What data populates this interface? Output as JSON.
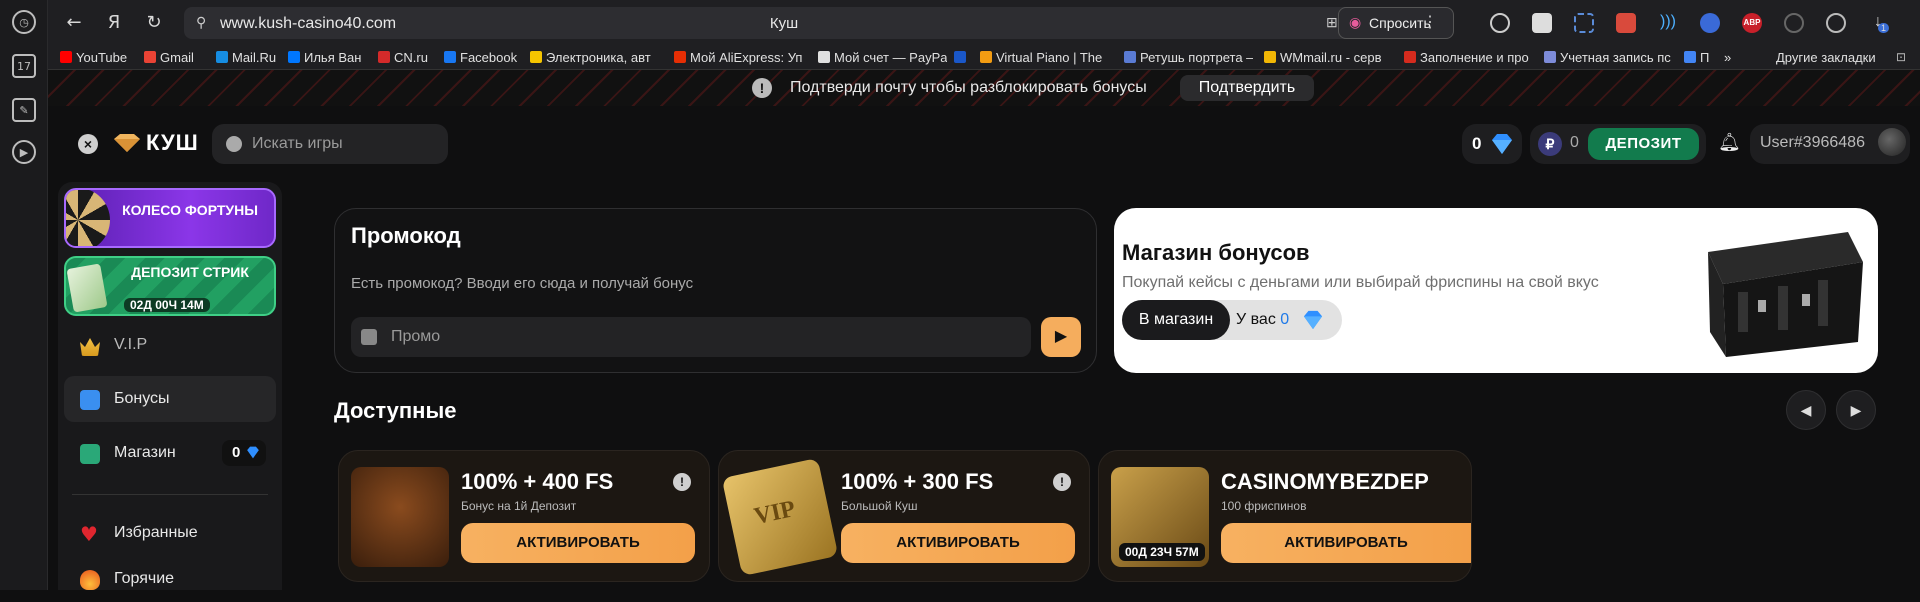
{
  "browser": {
    "url": "www.kush-casino40.com",
    "tab_title": "Куш",
    "ask_label": "Спросить",
    "rail_badge": "17",
    "bookmarks": [
      {
        "label": "YouTube",
        "color": "#ff0000"
      },
      {
        "label": "Gmail",
        "color": "#ea4335"
      },
      {
        "label": "Mail.Ru",
        "color": "#168de2"
      },
      {
        "label": "Илья Ван",
        "color": "#0077ff"
      },
      {
        "label": "CN.ru",
        "color": "#d42a2a"
      },
      {
        "label": "Facebook",
        "color": "#1877f2"
      },
      {
        "label": "Электроника, авт",
        "color": "#f5c400"
      },
      {
        "label": "Мой AliExpress: Уп",
        "color": "#e62e04"
      },
      {
        "label": "Мой счет — PayPa",
        "color": "#e0e0e0"
      },
      {
        "label": "",
        "color": "#1a57c8"
      },
      {
        "label": "Virtual Piano | The",
        "color": "#f39c12"
      },
      {
        "label": "Ретушь портрета –",
        "color": "#5a7bd4"
      },
      {
        "label": "WMmail.ru - серв",
        "color": "#f2b705"
      },
      {
        "label": "Заполнение и про",
        "color": "#d52b1e"
      },
      {
        "label": "Учетная запись пс",
        "color": "#7d8bd9"
      },
      {
        "label": "П",
        "color": "#4285f4"
      }
    ],
    "more_bookmarks": "»",
    "other_bookmarks": "Другие закладки",
    "ext_badge": "1"
  },
  "notice": {
    "text": "Подтверди почту чтобы разблокировать бонусы",
    "button": "Подтвердить"
  },
  "header": {
    "logo": "КУШ",
    "search_placeholder": "Искать игры",
    "gems": "0",
    "rub": "0",
    "deposit": "ДЕПОЗИТ",
    "user": "User#3966486"
  },
  "sidebar": {
    "wheel": "КОЛЕСО ФОРТУНЫ",
    "streak": "ДЕПОЗИТ СТРИК",
    "streak_timer": "02Д 00Ч 14М",
    "items": [
      {
        "label": "V.I.P"
      },
      {
        "label": "Бонусы"
      },
      {
        "label": "Магазин",
        "badge": "0"
      },
      {
        "label": "Избранные"
      },
      {
        "label": "Горячие"
      }
    ]
  },
  "promo": {
    "title": "Промокод",
    "subtitle": "Есть промокод? Вводи его сюда и получай бонус",
    "placeholder": "Промо"
  },
  "shop": {
    "title": "Магазин бонусов",
    "subtitle": "Покупай кейсы с деньгами или выбирай фриспины на свой вкус",
    "button": "В магазин",
    "have_label": "У вас",
    "have_count": "0"
  },
  "available": {
    "title": "Доступные",
    "cards": [
      {
        "title": "100% + 400 FS",
        "subtitle": "Бонус на 1й Депозит",
        "button": "АКТИВИРОВАТЬ",
        "timer": ""
      },
      {
        "title": "100% + 300 FS",
        "subtitle": "Большой Куш",
        "button": "АКТИВИРОВАТЬ",
        "timer": ""
      },
      {
        "title": "CASINOMYBEZDEP",
        "subtitle": "100 фриспинов",
        "button": "АКТИВИРОВАТЬ",
        "timer": "00Д 23Ч 57М"
      }
    ]
  },
  "colors": {
    "accent_orange": "#f5ad5d",
    "deposit_green": "#127b4d",
    "wheel_purple": "#7a2bd6",
    "streak_green": "#1e8f57",
    "gem_blue": "#2f8fff"
  }
}
